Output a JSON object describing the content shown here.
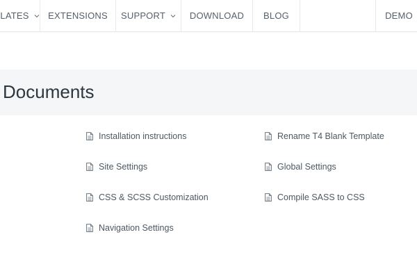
{
  "nav": {
    "items": [
      {
        "label": "LATES",
        "has_dropdown": true
      },
      {
        "label": "EXTENSIONS",
        "has_dropdown": false
      },
      {
        "label": "SUPPORT",
        "has_dropdown": true
      },
      {
        "label": "DOWNLOAD",
        "has_dropdown": false
      },
      {
        "label": "BLOG",
        "has_dropdown": false
      },
      {
        "label": "DEMO",
        "has_dropdown": false
      }
    ]
  },
  "page": {
    "title": "Documents"
  },
  "documents": {
    "left": [
      {
        "label": "Installation instructions",
        "icon": "document-icon"
      },
      {
        "label": "Site Settings",
        "icon": "document-icon"
      },
      {
        "label": "CSS & SCSS Customization",
        "icon": "document-icon"
      },
      {
        "label": "Navigation Settings",
        "icon": "document-icon"
      }
    ],
    "right": [
      {
        "label": "Rename T4 Blank Template",
        "icon": "document-icon"
      },
      {
        "label": "Global Settings",
        "icon": "document-icon"
      },
      {
        "label": "Compile SASS to CSS",
        "icon": "document-icon"
      }
    ]
  },
  "colors": {
    "hero_background": "#f4f6f7",
    "nav_border": "#e6e8ea",
    "text": "#4d5862",
    "title": "#2d3740"
  }
}
